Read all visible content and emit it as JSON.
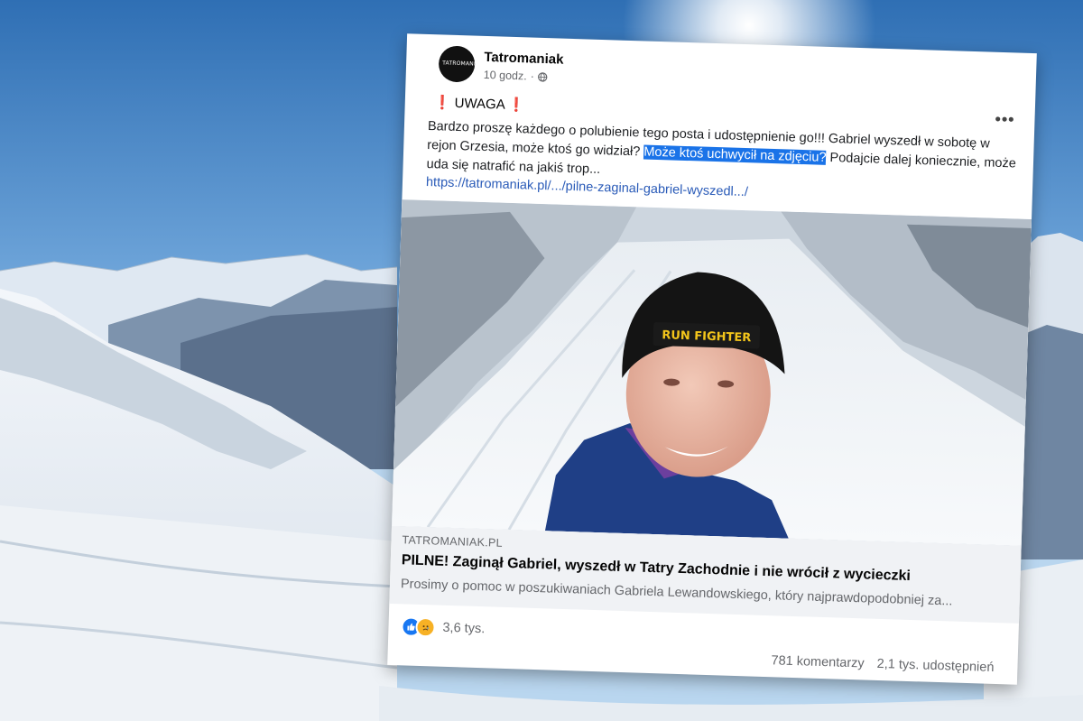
{
  "post": {
    "page_name": "Tatromaniak",
    "time": "10 godz.",
    "dot": "·",
    "avatar_logo": "TATROMANIAK",
    "more": "•••",
    "headline_mark_left": "❗",
    "headline": "UWAGA",
    "headline_mark_right": "❗",
    "text_before": "Bardzo proszę każdego o polubienie tego posta i udostępnienie go!!! Gabriel wyszedł w sobotę w rejon Grzesia, może ktoś go widział? ",
    "text_highlight": "Może ktoś uchwycił na zdjęciu?",
    "text_after": " Podajcie dalej koniecznie, może uda się natrafić na jakiś trop...",
    "link": "https://tatromaniak.pl/.../pilne-zaginal-gabriel-wyszedl.../",
    "hat_text": "RUN FIGHTER"
  },
  "preview": {
    "domain": "TATROMANIAK.PL",
    "title": "PILNE! Zaginął Gabriel, wyszedł w Tatry Zachodnie i nie wrócił z wycieczki",
    "description": "Prosimy o pomoc w poszukiwaniach Gabriela Lewandowskiego, który najprawdopodobniej za..."
  },
  "footer": {
    "reactions": [
      "like",
      "sad"
    ],
    "reaction_count": "3,6 tys.",
    "comments": "781 komentarzy",
    "shares": "2,1 tys. udostępnień"
  },
  "colors": {
    "sky_top": "#2f6fb4",
    "highlight": "#1a73e8",
    "link": "#2a5bb8",
    "like_blue": "#1877f2",
    "sad_yellow": "#f7b125",
    "alert_red": "#e41e3f"
  }
}
